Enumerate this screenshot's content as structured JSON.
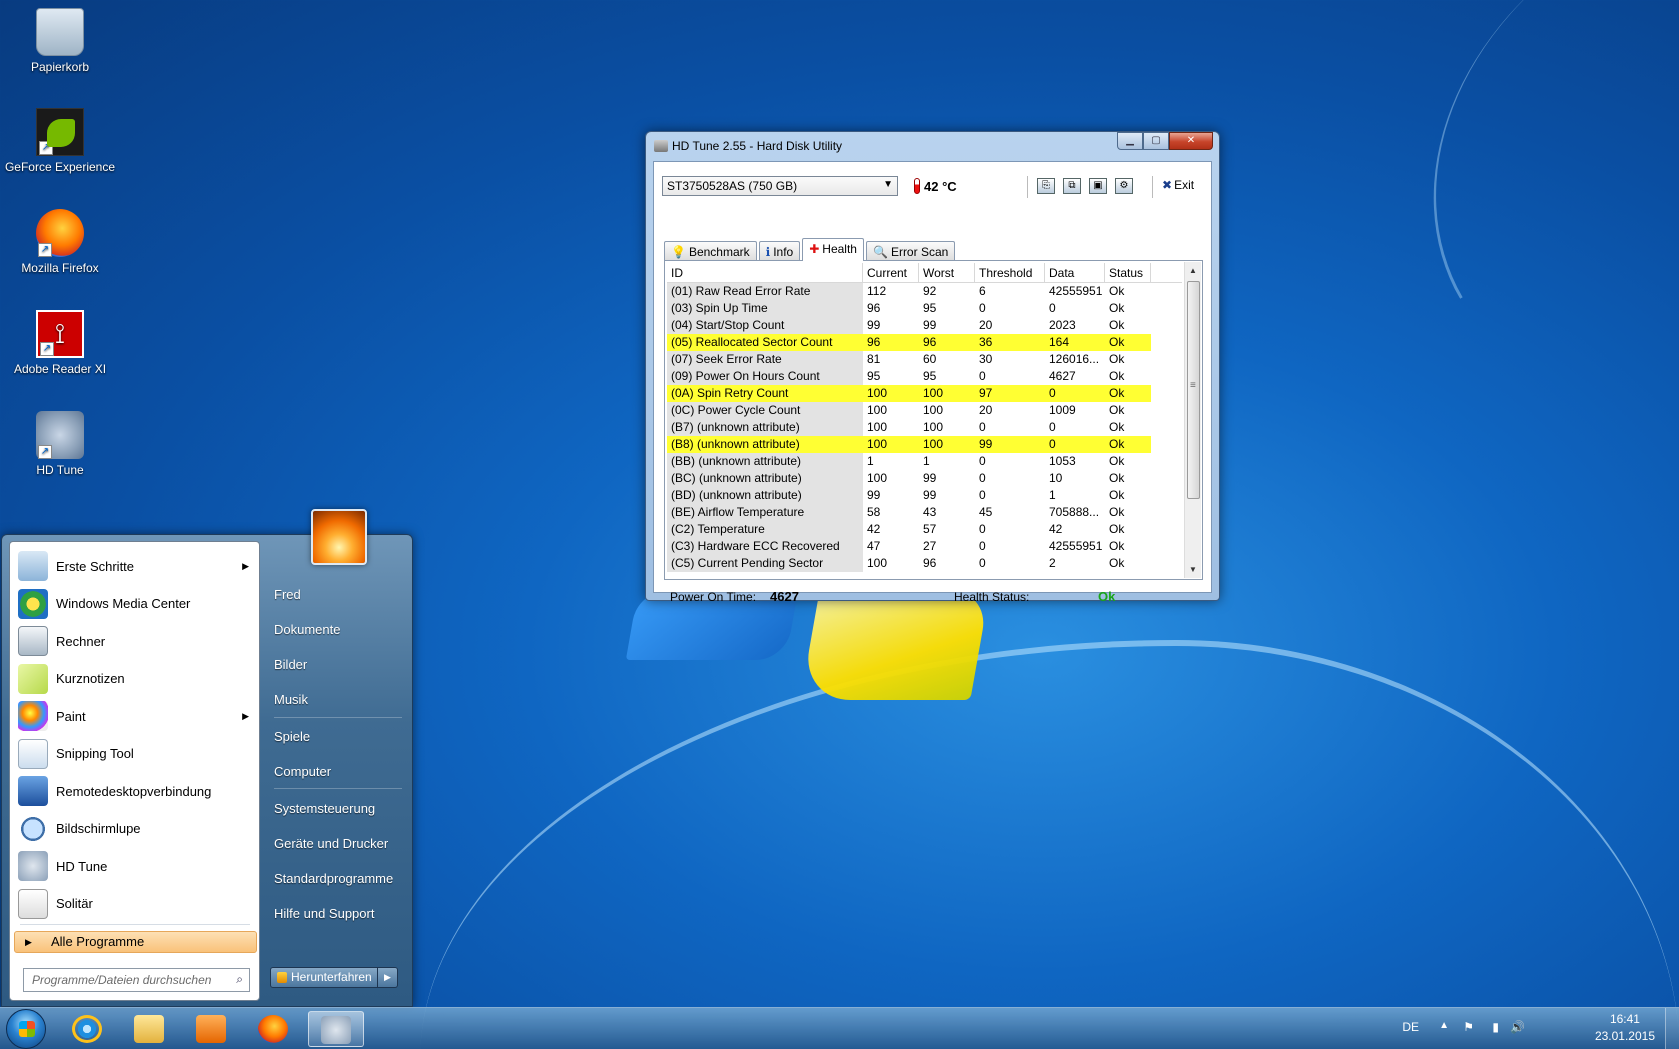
{
  "desktop_icons": [
    {
      "label": "Papierkorb",
      "icon": "recycle-bin-icon"
    },
    {
      "label": "GeForce Experience",
      "icon": "geforce-icon"
    },
    {
      "label": "Mozilla Firefox",
      "icon": "firefox-icon"
    },
    {
      "label": "Adobe Reader XI",
      "icon": "adobe-reader-icon"
    },
    {
      "label": "HD Tune",
      "icon": "hd-tune-icon"
    }
  ],
  "window": {
    "title": "HD Tune 2.55 - Hard Disk Utility",
    "controls": {
      "minimize": "▁",
      "maximize": "▢",
      "close": "✕"
    },
    "drive": "ST3750528AS (750 GB)",
    "temperature": "42 °C",
    "exit_label": "Exit",
    "tabs": [
      {
        "label": "Benchmark",
        "icon": "benchmark-icon",
        "glyph": "💡"
      },
      {
        "label": "Info",
        "icon": "info-icon",
        "glyph": "ℹ"
      },
      {
        "label": "Health",
        "icon": "health-cross-icon",
        "glyph": "✚"
      },
      {
        "label": "Error Scan",
        "icon": "magnifier-icon",
        "glyph": "🔍"
      }
    ],
    "active_tab": "Health",
    "table": {
      "columns": [
        "ID",
        "Current",
        "Worst",
        "Threshold",
        "Data",
        "Status"
      ],
      "rows": [
        {
          "id": "(01) Raw Read Error Rate",
          "current": "112",
          "worst": "92",
          "threshold": "6",
          "data": "42555951",
          "status": "Ok",
          "highlight": false
        },
        {
          "id": "(03) Spin Up Time",
          "current": "96",
          "worst": "95",
          "threshold": "0",
          "data": "0",
          "status": "Ok",
          "highlight": false
        },
        {
          "id": "(04) Start/Stop Count",
          "current": "99",
          "worst": "99",
          "threshold": "20",
          "data": "2023",
          "status": "Ok",
          "highlight": false
        },
        {
          "id": "(05) Reallocated Sector Count",
          "current": "96",
          "worst": "96",
          "threshold": "36",
          "data": "164",
          "status": "Ok",
          "highlight": true
        },
        {
          "id": "(07) Seek Error Rate",
          "current": "81",
          "worst": "60",
          "threshold": "30",
          "data": "126016...",
          "status": "Ok",
          "highlight": false
        },
        {
          "id": "(09) Power On Hours Count",
          "current": "95",
          "worst": "95",
          "threshold": "0",
          "data": "4627",
          "status": "Ok",
          "highlight": false
        },
        {
          "id": "(0A) Spin Retry Count",
          "current": "100",
          "worst": "100",
          "threshold": "97",
          "data": "0",
          "status": "Ok",
          "highlight": true
        },
        {
          "id": "(0C) Power Cycle Count",
          "current": "100",
          "worst": "100",
          "threshold": "20",
          "data": "1009",
          "status": "Ok",
          "highlight": false
        },
        {
          "id": "(B7) (unknown attribute)",
          "current": "100",
          "worst": "100",
          "threshold": "0",
          "data": "0",
          "status": "Ok",
          "highlight": false
        },
        {
          "id": "(B8) (unknown attribute)",
          "current": "100",
          "worst": "100",
          "threshold": "99",
          "data": "0",
          "status": "Ok",
          "highlight": true
        },
        {
          "id": "(BB) (unknown attribute)",
          "current": "1",
          "worst": "1",
          "threshold": "0",
          "data": "1053",
          "status": "Ok",
          "highlight": false
        },
        {
          "id": "(BC) (unknown attribute)",
          "current": "100",
          "worst": "99",
          "threshold": "0",
          "data": "10",
          "status": "Ok",
          "highlight": false
        },
        {
          "id": "(BD) (unknown attribute)",
          "current": "99",
          "worst": "99",
          "threshold": "0",
          "data": "1",
          "status": "Ok",
          "highlight": false
        },
        {
          "id": "(BE) Airflow Temperature",
          "current": "58",
          "worst": "43",
          "threshold": "45",
          "data": "705888...",
          "status": "Ok",
          "highlight": false
        },
        {
          "id": "(C2) Temperature",
          "current": "42",
          "worst": "57",
          "threshold": "0",
          "data": "42",
          "status": "Ok",
          "highlight": false
        },
        {
          "id": "(C3) Hardware ECC Recovered",
          "current": "47",
          "worst": "27",
          "threshold": "0",
          "data": "42555951",
          "status": "Ok",
          "highlight": false
        },
        {
          "id": "(C5) Current Pending Sector",
          "current": "100",
          "worst": "96",
          "threshold": "0",
          "data": "2",
          "status": "Ok",
          "highlight": false
        }
      ]
    },
    "footer": {
      "power_on_label": "Power On Time:",
      "power_on_value": "4627",
      "health_label": "Health Status:",
      "health_value": "Ok"
    },
    "colors": {
      "highlight": "#ffff33",
      "ok_green": "#1aa51a"
    }
  },
  "start_menu": {
    "programs": [
      {
        "label": "Erste Schritte",
        "icon": "getting-started-icon",
        "submenu": true
      },
      {
        "label": "Windows Media Center",
        "icon": "media-center-icon",
        "submenu": false
      },
      {
        "label": "Rechner",
        "icon": "calculator-icon",
        "submenu": false
      },
      {
        "label": "Kurznotizen",
        "icon": "sticky-notes-icon",
        "submenu": false
      },
      {
        "label": "Paint",
        "icon": "paint-icon",
        "submenu": true
      },
      {
        "label": "Snipping Tool",
        "icon": "snipping-tool-icon",
        "submenu": false
      },
      {
        "label": "Remotedesktopverbindung",
        "icon": "remote-desktop-icon",
        "submenu": false
      },
      {
        "label": "Bildschirmlupe",
        "icon": "magnifier-icon",
        "submenu": false
      },
      {
        "label": "HD Tune",
        "icon": "hd-tune-icon",
        "submenu": false
      },
      {
        "label": "Solitär",
        "icon": "solitaire-icon",
        "submenu": false
      }
    ],
    "all_programs": "Alle Programme",
    "search_placeholder": "Programme/Dateien durchsuchen",
    "right_items": [
      {
        "label": "Fred"
      },
      {
        "label": "Dokumente"
      },
      {
        "label": "Bilder"
      },
      {
        "label": "Musik"
      },
      {
        "label": "Spiele"
      },
      {
        "label": "Computer"
      },
      {
        "label": "Systemsteuerung"
      },
      {
        "label": "Geräte und Drucker"
      },
      {
        "label": "Standardprogramme"
      },
      {
        "label": "Hilfe und Support"
      }
    ],
    "shutdown_label": "Herunterfahren"
  },
  "taskbar": {
    "apps": [
      {
        "name": "internet-explorer",
        "icon": "internet-explorer-icon"
      },
      {
        "name": "explorer",
        "icon": "folder-icon"
      },
      {
        "name": "media-player",
        "icon": "media-player-icon"
      },
      {
        "name": "firefox",
        "icon": "firefox-icon"
      },
      {
        "name": "hd-tune",
        "icon": "hd-tune-icon",
        "active": true
      }
    ],
    "language": "DE",
    "time": "16:41",
    "date": "23.01.2015"
  }
}
